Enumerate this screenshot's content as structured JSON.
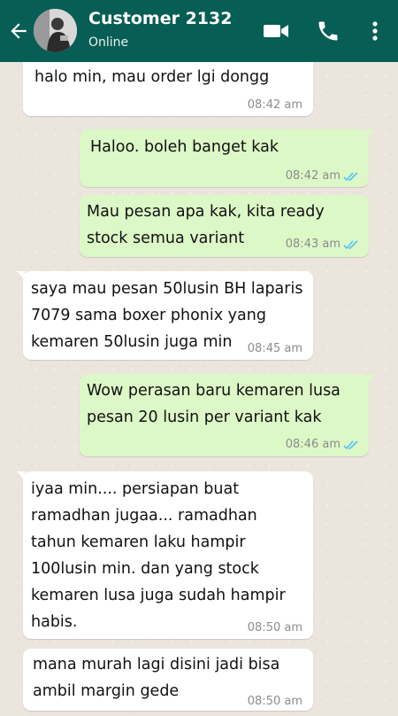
{
  "header": {
    "contact_name": "Customer 2132",
    "status": "Online"
  },
  "messages": [
    {
      "direction": "in",
      "text": "halo min, mau order lgi dongg",
      "time": "08:42 am"
    },
    {
      "direction": "out",
      "text": "Haloo. boleh banget kak",
      "time": "08:42 am",
      "read": true
    },
    {
      "direction": "out",
      "text": "Mau pesan apa kak, kita ready\nstock semua variant",
      "time": "08:43 am",
      "read": true
    },
    {
      "direction": "in",
      "text": "saya mau pesan 50lusin BH laparis\n7079 sama boxer phonix yang\nkemaren 50lusin juga min",
      "time": "08:45 am"
    },
    {
      "direction": "out",
      "text": "Wow perasan baru kemaren lusa\npesan 20 lusin per variant kak",
      "time": "08:46 am",
      "read": true
    },
    {
      "direction": "in",
      "text": "iyaa min.... persiapan buat\nramadhan jugaa... ramadhan\ntahun kemaren laku hampir\n100lusin min. dan yang stock\nkemaren lusa juga sudah hampir\nhabis.",
      "time": "08:50 am"
    },
    {
      "direction": "in",
      "text": "mana murah lagi disini jadi bisa\nambil margin gede",
      "time": "08:50 am"
    }
  ],
  "colors": {
    "header": "#075e54",
    "incoming_bubble": "#ffffff",
    "outgoing_bubble": "#dcf8c6",
    "read_ticks": "#4fc3f7",
    "background": "#ece5dd"
  },
  "icons": [
    "back-arrow-icon",
    "video-call-icon",
    "phone-icon",
    "more-options-icon",
    "double-check-icon"
  ]
}
